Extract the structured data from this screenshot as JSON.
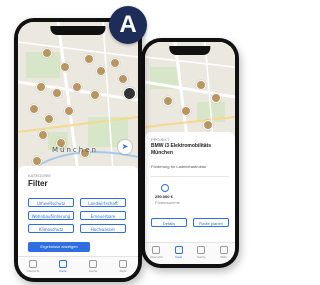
{
  "badge": {
    "label": "A"
  },
  "left_phone": {
    "map": {
      "city_label": "München",
      "locate_icon": "location-arrow-icon"
    },
    "sheet": {
      "kicker": "Kategorie",
      "title": "Filter",
      "chips": [
        "Umweltschutz",
        "Landwirtschaft",
        "Wohnbauförderung",
        "Erneuerbare",
        "Klimaschutz",
        "Hochwasser"
      ],
      "primary_button": "Ergebnisse anzeigen"
    },
    "tabs": [
      {
        "label": "Übersicht",
        "icon": "home-icon",
        "active": false
      },
      {
        "label": "Karte",
        "icon": "map-icon",
        "active": true
      },
      {
        "label": "Suche",
        "icon": "search-icon",
        "active": false
      },
      {
        "label": "Mehr",
        "icon": "menu-icon",
        "active": false
      }
    ]
  },
  "right_phone": {
    "sheet": {
      "kicker": "Projekt",
      "title_line1": "BMW i3 Elektromobilitäts",
      "title_line2": "München",
      "subtitle": "Förderung für Ladeinfrastruktur",
      "stat_value": "250.000 €",
      "stat_label": "Fördersumme",
      "button_left": "Details",
      "button_right": "Route planen"
    },
    "tabs": [
      {
        "label": "Übersicht",
        "icon": "home-icon",
        "active": false
      },
      {
        "label": "Karte",
        "icon": "map-icon",
        "active": true
      },
      {
        "label": "Suche",
        "icon": "search-icon",
        "active": false
      },
      {
        "label": "Mehr",
        "icon": "menu-icon",
        "active": false
      }
    ]
  },
  "colors": {
    "accent": "#2f6ee0",
    "badge": "#1e2d57",
    "pin": "#b9955f"
  }
}
